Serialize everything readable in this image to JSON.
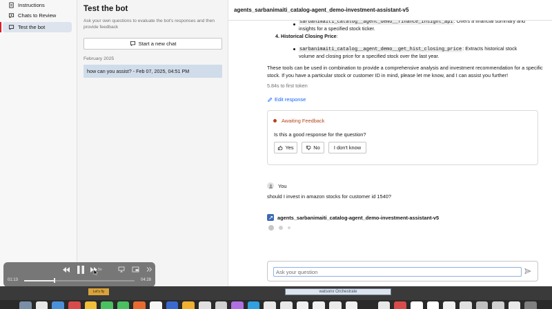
{
  "nav": {
    "items": [
      {
        "label": "Instructions",
        "icon": "document-icon",
        "active": false
      },
      {
        "label": "Chats to Review",
        "icon": "chat-review-icon",
        "active": false
      },
      {
        "label": "Test the bot",
        "icon": "chat-icon",
        "active": true
      }
    ]
  },
  "chats_panel": {
    "title": "Test the bot",
    "description": "Ask your own questions to evaluate the bot's responses and then provide feedback",
    "new_chat_label": "Start a new chat",
    "group_label": "February 2025",
    "items": [
      {
        "label": "how can you assist? - Feb 07, 2025, 04:51 PM"
      }
    ]
  },
  "main": {
    "header_title": "agents_sarbanimaiti_catalog-agent_demo-investment-assistant-v5",
    "response": {
      "tool3_code": "sarbanimaiti_catalog__agent_demo__finance_insight_api",
      "tool3_desc": ": Offers a financial summary and",
      "tool3_desc2": "insights for a specified stock ticker.",
      "item4_number": "4.",
      "item4_title": "Historical Closing Price",
      "item4_colon": ":",
      "tool4_code": "sarbanimaiti_catalog__agent_demo__get_hist_closing_price",
      "tool4_desc": ": Extracts historical stock",
      "tool4_desc2": "volume and closing price for a specified stock over the last year.",
      "summary": "These tools can be used in combination to provide a comprehensive analysis and investment recommendation for a specific stock. If you have a particular stock or customer ID in mind, please let me know, and I can assist you further!",
      "latency": "5.84s to first token",
      "edit_label": "Edit response"
    },
    "feedback": {
      "status": "Awaiting Feedback",
      "question": "Is this a good response for the question?",
      "yes_label": "Yes",
      "no_label": "No",
      "dont_know_label": "I don't know",
      "status_color": "#b5451b"
    },
    "user": {
      "name": "You",
      "message": "should I invest in amazon stocks for customer id 1540?"
    },
    "agent": {
      "name": "agents_sarbanimaiti_catalog-agent_demo-investment-assistant-v5"
    },
    "input": {
      "placeholder": "Ask your question",
      "value": ""
    }
  },
  "player": {
    "time_elapsed": "01:13",
    "time_total": "04:28",
    "progress": 0.27,
    "speed_label": "5x"
  },
  "footer": {
    "badge_text": "Let's fly",
    "watsonx_label": "watsonx Orchestrate"
  },
  "dock": {
    "icon_colors": [
      "#7a8fa6",
      "#e8e8e8",
      "#4a90d9",
      "#d94a4a",
      "#f0c03a",
      "#4ac060",
      "#4ac060",
      "#e86a30",
      "#f5f5f5",
      "#3a6ad0",
      "#f0b030",
      "#e0e0e0",
      "#d0d0d0",
      "#b070e0",
      "#30a0e0",
      "#e8e8e8",
      "#e8e8e8",
      "#f0f0f0",
      "#f0f0f0",
      "#eaeaea",
      "#f0f0f0",
      "#2a2a2a",
      "#e8e8e8",
      "#d94a4a",
      "#ffffff",
      "#ffffff",
      "#f0f0f0",
      "#e0e0e0",
      "#c0c0c0",
      "#d0d0d0",
      "#e8e8e8",
      "#808080"
    ]
  }
}
